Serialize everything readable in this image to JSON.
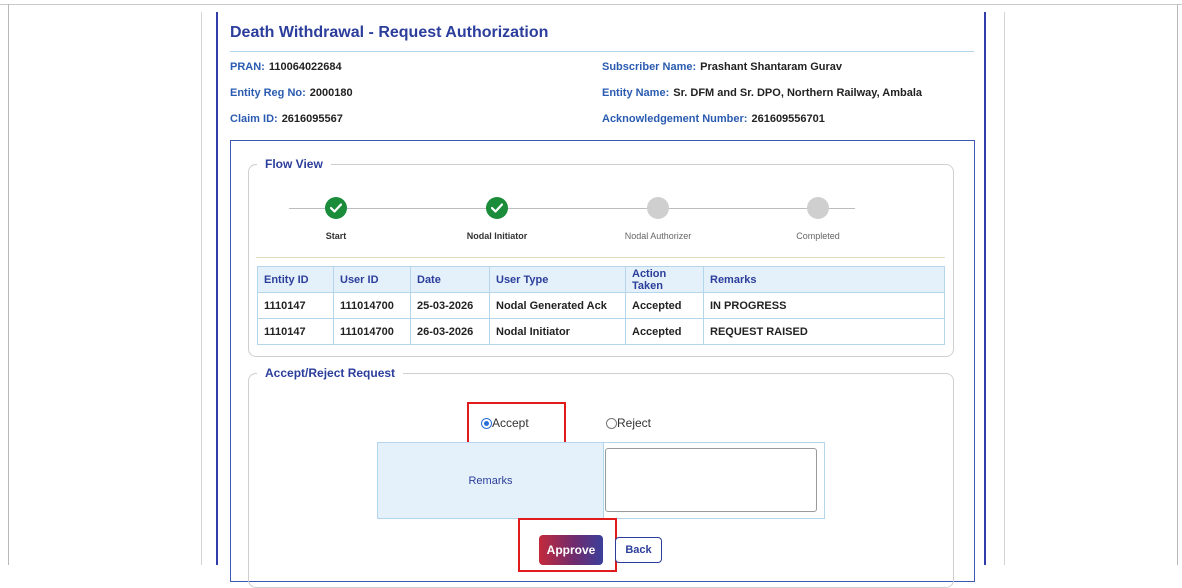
{
  "page": {
    "title": "Death Withdrawal - Request Authorization"
  },
  "info": {
    "pran_label": "PRAN:",
    "pran_value": "110064022684",
    "subscriber_label": "Subscriber Name:",
    "subscriber_value": "Prashant Shantaram Gurav",
    "entity_reg_label": "Entity Reg No:",
    "entity_reg_value": "2000180",
    "entity_name_label": "Entity Name:",
    "entity_name_value": "Sr. DFM and Sr. DPO, Northern Railway, Ambala",
    "claim_label": "Claim ID:",
    "claim_value": "2616095567",
    "ack_label": "Acknowledgement Number:",
    "ack_value": "261609556701"
  },
  "flow": {
    "legend": "Flow View",
    "steps": [
      {
        "label": "Start",
        "status": "done"
      },
      {
        "label": "Nodal Initiator",
        "status": "done"
      },
      {
        "label": "Nodal Authorizer",
        "status": "pending"
      },
      {
        "label": "Completed",
        "status": "pending"
      }
    ]
  },
  "log_table": {
    "headers": [
      "Entity ID",
      "User ID",
      "Date",
      "User Type",
      "Action Taken",
      "Remarks"
    ],
    "rows": [
      [
        "1110147",
        "111014700",
        "25-03-2026",
        "Nodal Generated Ack",
        "Accepted",
        "IN PROGRESS"
      ],
      [
        "1110147",
        "111014700",
        "26-03-2026",
        "Nodal Initiator",
        "Accepted",
        "REQUEST RAISED"
      ]
    ]
  },
  "decision": {
    "legend": "Accept/Reject Request",
    "accept_label": "Accept",
    "reject_label": "Reject",
    "selected": "Accept",
    "remarks_label": "Remarks",
    "remarks_value": "",
    "approve_label": "Approve",
    "back_label": "Back"
  },
  "colors": {
    "accent": "#2c3e9b",
    "done_step": "#1a8c3a",
    "pending_step": "#cfcfcf",
    "highlight": "#e01b1b"
  }
}
